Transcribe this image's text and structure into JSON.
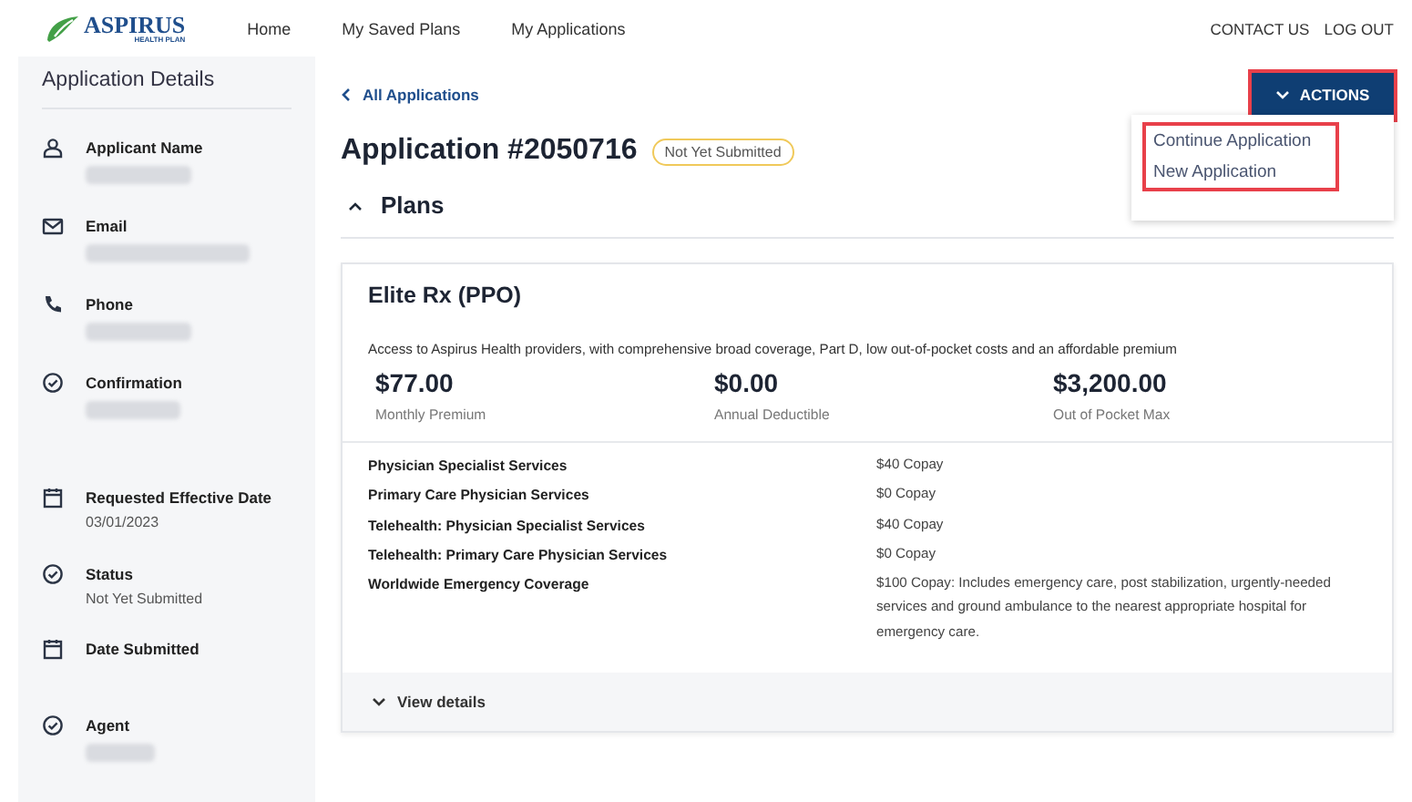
{
  "logo": {
    "name": "ASPIRUS",
    "tagline": "HEALTH PLAN"
  },
  "nav": [
    "Home",
    "My Saved Plans",
    "My Applications"
  ],
  "top_links": [
    "CONTACT US",
    "LOG OUT"
  ],
  "sidebar": {
    "title": "Application Details",
    "items": [
      {
        "kind": "person",
        "label": "Applicant Name",
        "redacted": true
      },
      {
        "kind": "mail",
        "label": "Email",
        "redacted": true
      },
      {
        "kind": "phone",
        "label": "Phone",
        "redacted": true
      },
      {
        "kind": "check",
        "label": "Confirmation",
        "redacted": true
      },
      {
        "kind": "calendar",
        "label": "Requested Effective Date",
        "value": "03/01/2023",
        "redacted": false
      },
      {
        "kind": "check",
        "label": "Status",
        "value": "Not Yet Submitted",
        "redacted": false
      },
      {
        "kind": "calendar",
        "label": "Date Submitted",
        "redacted": false
      },
      {
        "kind": "check",
        "label": "Agent",
        "redacted": true
      }
    ]
  },
  "back_link": "All Applications",
  "title": "Application #2050716",
  "status_badge": "Not Yet Submitted",
  "actions": {
    "label": "ACTIONS",
    "highlighted": true,
    "expanded": true,
    "menu": [
      "Continue Application",
      "New Application"
    ],
    "menu_highlighted": true
  },
  "section": {
    "title": "Plans",
    "expanded": true
  },
  "plan": {
    "name": "Elite Rx (PPO)",
    "description": "Access to Aspirus Health providers, with comprehensive broad coverage, Part D, low out-of-pocket costs and an affordable premium",
    "stats": [
      {
        "value": "$77.00",
        "label": "Monthly Premium"
      },
      {
        "value": "$0.00",
        "label": "Annual Deductible"
      },
      {
        "value": "$3,200.00",
        "label": "Out of Pocket Max"
      }
    ],
    "benefits": [
      {
        "name": "Physician Specialist Services",
        "value": "$40 Copay"
      },
      {
        "name": "Primary Care Physician Services",
        "value": "$0 Copay"
      },
      {
        "name": "Telehealth: Physician Specialist Services",
        "value": "$40 Copay"
      },
      {
        "name": "Telehealth: Primary Care Physician Services",
        "value": "$0 Copay"
      },
      {
        "name": "Worldwide Emergency Coverage",
        "value": "$100 Copay: Includes emergency care, post stabilization, urgently-needed services and ground ambulance to the nearest appropriate hospital for emergency care."
      }
    ],
    "details_link": "View details",
    "details_expanded": false
  }
}
